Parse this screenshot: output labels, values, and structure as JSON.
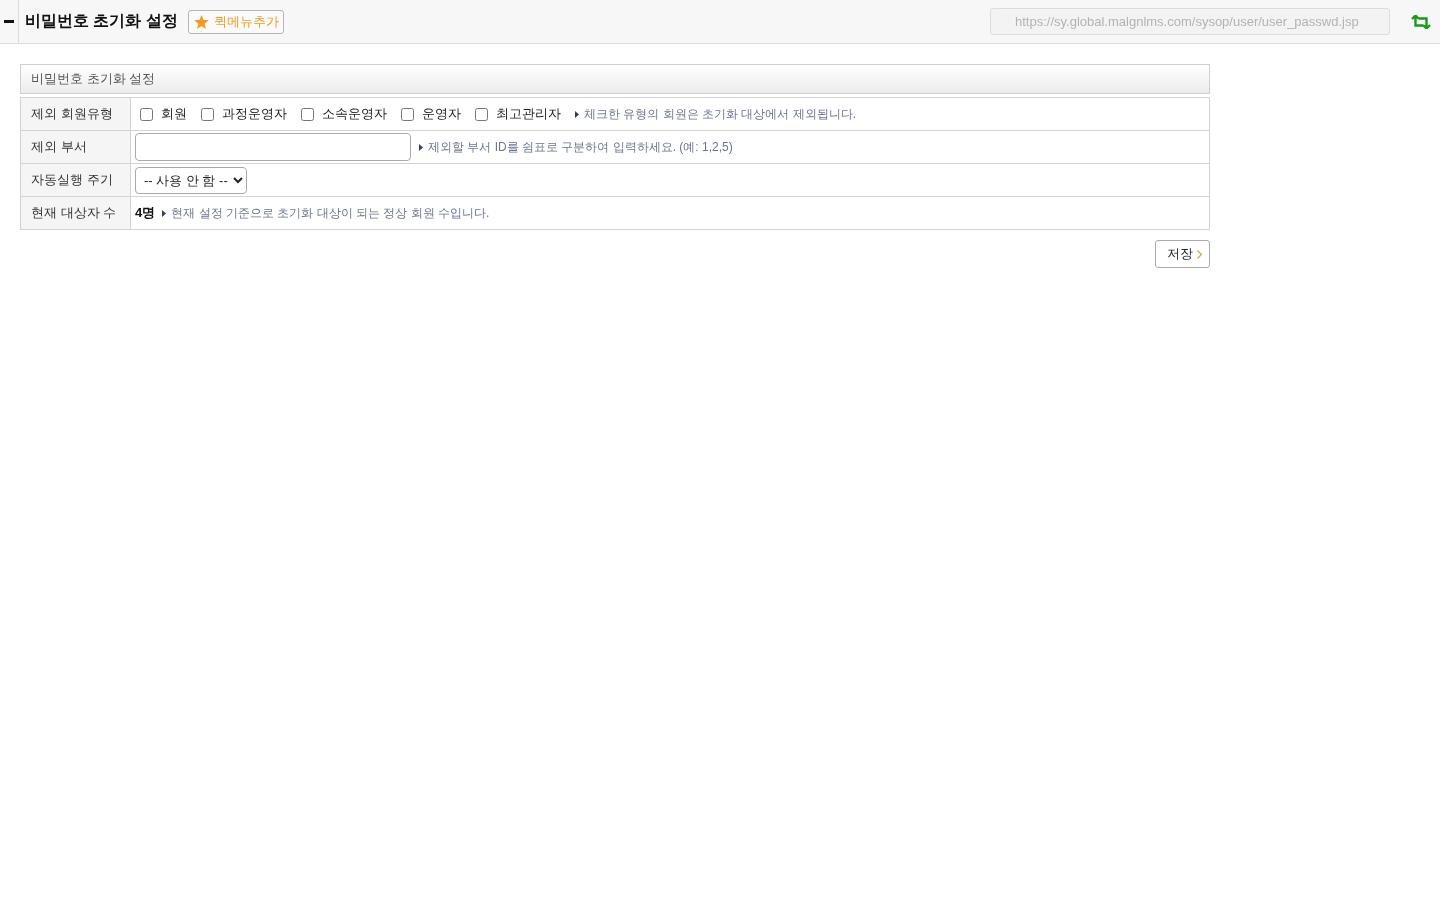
{
  "header": {
    "title": "비밀번호 초기화 설정",
    "quick_menu_button": "퀵메뉴추가",
    "url_field": {
      "value": "https://sy.global.malgnlms.com/sysop/user/user_passwd.jsp",
      "disabled": true
    }
  },
  "panel": {
    "title": "비밀번호 초기화 설정",
    "rows": [
      {
        "kind": "checkboxes",
        "label": "제외 회원유형",
        "options": [
          {
            "label": "회원",
            "checked": false
          },
          {
            "label": "과정운영자",
            "checked": false
          },
          {
            "label": "소속운영자",
            "checked": false
          },
          {
            "label": "운영자",
            "checked": false
          },
          {
            "label": "최고관리자",
            "checked": false
          }
        ],
        "hint": "체크한 유형의 회원은 초기화 대상에서 제외됩니다."
      },
      {
        "kind": "text",
        "label": "제외 부서",
        "hint": "제외할 부서 ID를 쉼표로 구분하여 입력하세요. (예: 1,2,5)"
      },
      {
        "kind": "select",
        "label": "자동실행 주기",
        "value": "-- 사용 안 함 --"
      },
      {
        "kind": "count",
        "label": "현재 대상자 수",
        "value": "4명",
        "hint": "현재 설정 기준으로 초기화 대상이 되는 정상 회원 수입니다."
      }
    ]
  },
  "save_button": "저장"
}
